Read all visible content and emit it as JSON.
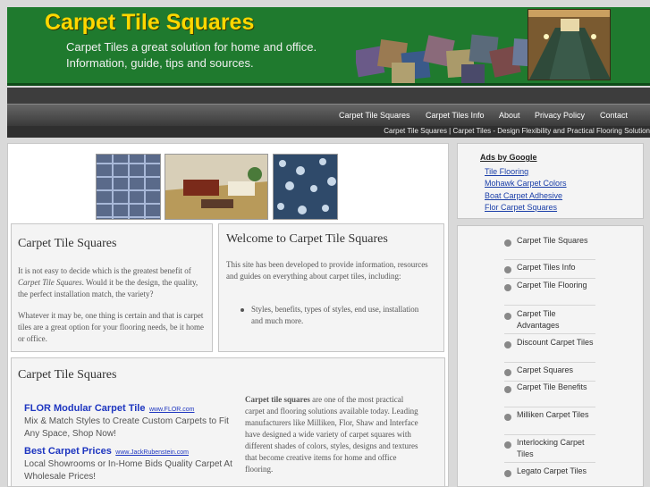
{
  "header": {
    "title": "Carpet Tile Squares",
    "tagline_1": "Carpet Tiles a great solution for home and office.",
    "tagline_2": "Information, guide, tips and sources."
  },
  "nav": {
    "items": [
      "Carpet Tile Squares",
      "Carpet Tiles Info",
      "About",
      "Privacy Policy",
      "Contact"
    ]
  },
  "breadcrumb": "Carpet Tile Squares | Carpet Tiles - Design Flexibility and Practical Flooring Solution",
  "box1": {
    "title": "Carpet Tile Squares",
    "p1_a": "It is not easy to decide which is the greatest benefit of ",
    "p1_em": "Carpet Tile Squares",
    "p1_b": ". Would it be the design, the quality, the perfect installation match, the variety?",
    "p2": "Whatever it may be, one thing is certain and that is carpet tiles are a great option for your flooring needs, be it home or office."
  },
  "box2": {
    "title": "Welcome to Carpet Tile Squares",
    "intro": "This site has been developed to provide information, resources and guides on everything about carpet tiles, including:",
    "bullet": "Styles, benefits, types of styles, end use, installation and much more."
  },
  "box3": {
    "title": "Carpet Tile Squares",
    "ads": [
      {
        "title": "FLOR Modular Carpet Tile",
        "url": "www.FLOR.com",
        "text": "Mix & Match Styles to Create Custom Carpets to Fit Any Space, Shop Now!"
      },
      {
        "title": "Best Carpet Prices",
        "url": "www.JackRubenstein.com",
        "text": "Local Showrooms or In-Home Bids Quality Carpet At Wholesale Prices!"
      }
    ],
    "body_strong": "Carpet tile squares",
    "body": " are one of the most practical carpet and flooring solutions available today. Leading manufacturers like Milliken, Flor, Shaw and Interface have designed a wide variety of carpet squares with different shades of colors, styles, designs and textures that become creative items for home and office flooring."
  },
  "ads_top": {
    "heading": "Ads by Google",
    "links": [
      "Tile Flooring",
      "Mohawk Carpet Colors",
      "Boat Carpet Adhesive",
      "Flor Carpet Squares"
    ]
  },
  "sidebar": {
    "items": [
      "Carpet Tile Squares",
      "Carpet Tiles Info",
      "Carpet Tile Flooring",
      "Carpet Tile Advantages",
      "Discount Carpet Tiles",
      "Carpet Squares",
      "Carpet Tile Benefits",
      "Milliken Carpet Tiles",
      "Interlocking Carpet Tiles",
      "Legato Carpet Tiles"
    ]
  },
  "colors": {
    "header_bg": "#1f7a2e",
    "title": "#ffd700",
    "link": "#1a3ea8"
  }
}
